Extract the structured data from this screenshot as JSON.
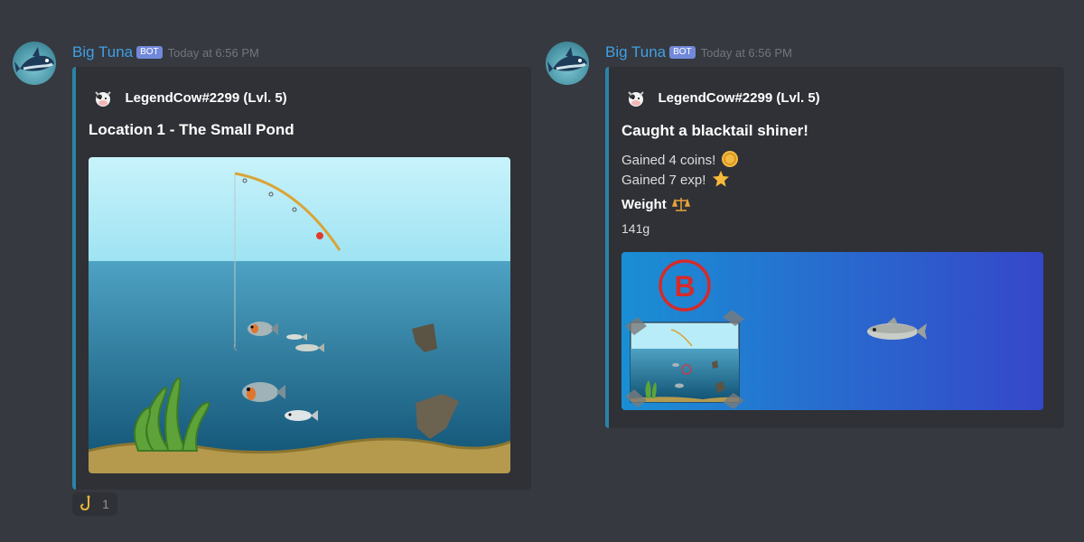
{
  "messages": [
    {
      "username": "Big Tuna",
      "bot_tag": "BOT",
      "timestamp": "Today at 6:56 PM",
      "embed": {
        "author": "LegendCow#2299 (Lvl. 5)",
        "title": "Location 1 - The Small Pond",
        "image": "fishing-pond-scene"
      },
      "reactions": [
        {
          "emoji": "fishing-hook-icon",
          "count": "1"
        }
      ]
    },
    {
      "username": "Big Tuna",
      "bot_tag": "BOT",
      "timestamp": "Today at 6:56 PM",
      "embed": {
        "author": "LegendCow#2299 (Lvl. 5)",
        "title": "Caught a blacktail shiner!",
        "lines": [
          "Gained 4 coins!",
          "Gained 7 exp!"
        ],
        "field_name": "Weight",
        "field_value": "141g",
        "image_badge": "B"
      }
    }
  ],
  "colors": {
    "background": "#36393f",
    "embed_bg": "#2f3136",
    "embed_border": "#2b83a8",
    "username": "#3fa0e6",
    "bot_tag": "#7289da"
  }
}
